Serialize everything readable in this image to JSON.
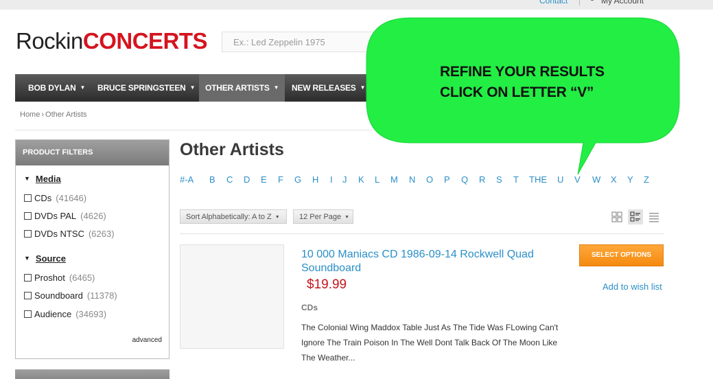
{
  "topbar": {
    "contact": "Contact",
    "account": "My Account"
  },
  "logo": {
    "part1": "Rockin",
    "part2": "CONCERTS"
  },
  "search": {
    "placeholder": "Ex.: Led Zeppelin 1975"
  },
  "nav": {
    "items": [
      {
        "label": "BOB DYLAN"
      },
      {
        "label": "BRUCE SPRINGSTEEN"
      },
      {
        "label": "OTHER ARTISTS"
      },
      {
        "label": "NEW RELEASES"
      }
    ]
  },
  "breadcrumb": {
    "home": "Home",
    "current": "Other Artists"
  },
  "filters": {
    "header": "Product Filters",
    "groups": [
      {
        "title": "Media",
        "options": [
          {
            "label": "CDs",
            "count": "(41646)"
          },
          {
            "label": "DVDs PAL",
            "count": "(4626)"
          },
          {
            "label": "DVDs NTSC",
            "count": "(6263)"
          }
        ]
      },
      {
        "title": "Source",
        "options": [
          {
            "label": "Proshot",
            "count": "(6465)"
          },
          {
            "label": "Soundboard",
            "count": "(11378)"
          },
          {
            "label": "Audience",
            "count": "(34693)"
          }
        ]
      }
    ],
    "advanced": "advanced"
  },
  "page_title": "Other Artists",
  "alphabet": [
    "#-A",
    "B",
    "C",
    "D",
    "E",
    "F",
    "G",
    "H",
    "I",
    "J",
    "K",
    "L",
    "M",
    "N",
    "O",
    "P",
    "Q",
    "R",
    "S",
    "T",
    "THE",
    "U",
    "V",
    "W",
    "X",
    "Y",
    "Z"
  ],
  "toolbar": {
    "sort": "Sort Alphabetically: A to Z",
    "per_page": "12 Per Page"
  },
  "product": {
    "title": "10 000 Maniacs CD 1986-09-14 Rockwell Quad Soundboard",
    "price": "$19.99",
    "category": "CDs",
    "description": "The Colonial Wing Maddox Table Just As The Tide Was FLowing Can't Ignore The Train Poison In The Well Dont Talk Back Of The Moon Like The Weather...",
    "select_button": "Select Options",
    "wishlist": "Add to wish list"
  },
  "callout": {
    "line1": "REFINE YOUR RESULTS",
    "line2": "CLICK ON LETTER “V”"
  },
  "colors": {
    "accent_red": "#d5141f",
    "link_blue": "#2a8fc8",
    "callout_green": "#22ee44",
    "button_orange": "#f7941d"
  }
}
